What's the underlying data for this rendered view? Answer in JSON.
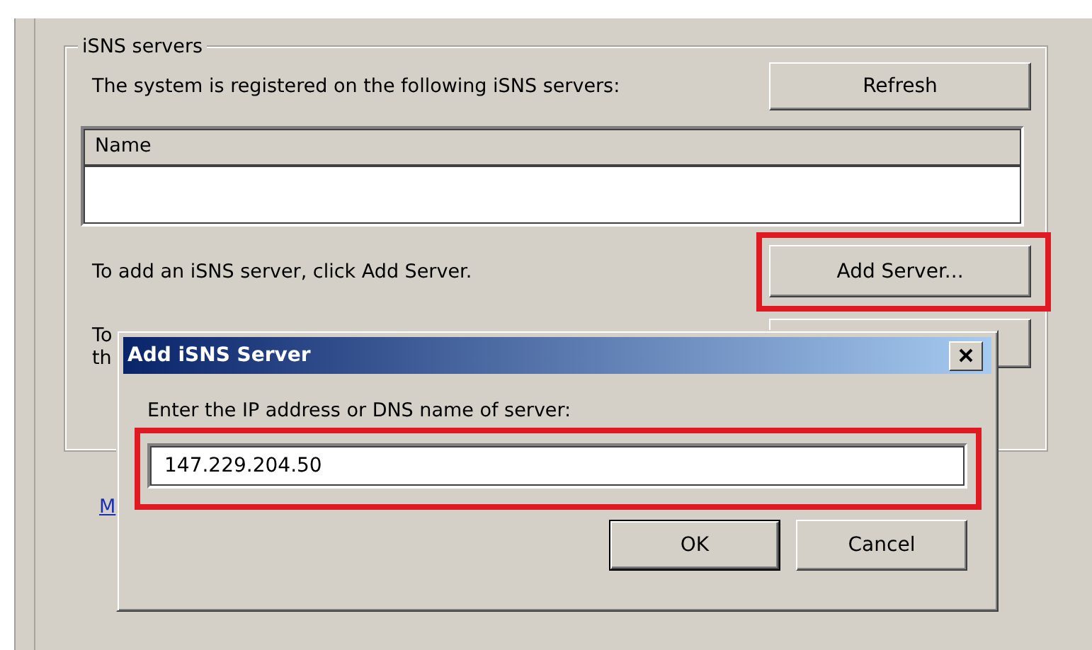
{
  "main": {
    "group_title": "iSNS servers",
    "registered_text": "The system is registered on the following iSNS servers:",
    "refresh_button": {
      "label": "Refresh"
    },
    "server_list": {
      "columns": [
        "Name"
      ]
    },
    "add_text": "To add an iSNS server, click Add Server.",
    "add_button": {
      "label": "Add Server...",
      "highlighted": true
    },
    "remove_text_lines": [
      "To",
      "th"
    ],
    "link_text": "M"
  },
  "dialog": {
    "title": "Add iSNS Server",
    "prompt": "Enter the IP address or DNS name of server:",
    "field": {
      "value": "147.229.204.50",
      "highlighted": true
    },
    "buttons": [
      {
        "label": "OK",
        "default": true
      },
      {
        "label": "Cancel",
        "default": false
      }
    ]
  }
}
